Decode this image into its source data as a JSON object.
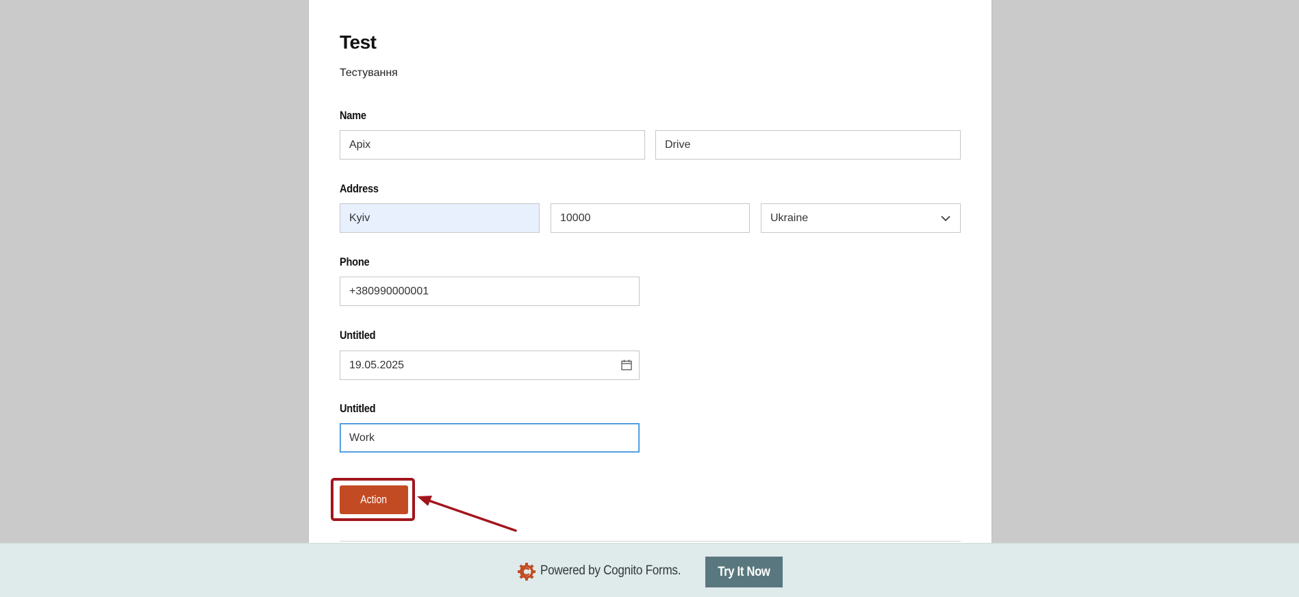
{
  "form": {
    "title": "Test",
    "description": "Тестування"
  },
  "fields": {
    "name": {
      "label": "Name",
      "first": "Apix",
      "last": "Drive"
    },
    "address": {
      "label": "Address",
      "city": "Kyiv",
      "postal_code": "10000",
      "country": "Ukraine"
    },
    "phone": {
      "label": "Phone",
      "value": "+380990000001"
    },
    "date": {
      "label": "Untitled",
      "value": "19.05.2025"
    },
    "text": {
      "label": "Untitled",
      "value": "Work"
    }
  },
  "action_button": {
    "label": "Action"
  },
  "footer": {
    "powered_by": "Powered by Cognito Forms.",
    "try_button": "Try It Now"
  },
  "colors": {
    "action": "#c34b23",
    "highlight": "#a2151d",
    "try_button": "#59777e",
    "footer_bg": "#dfeaea",
    "autofill": "#e8f0fe"
  }
}
